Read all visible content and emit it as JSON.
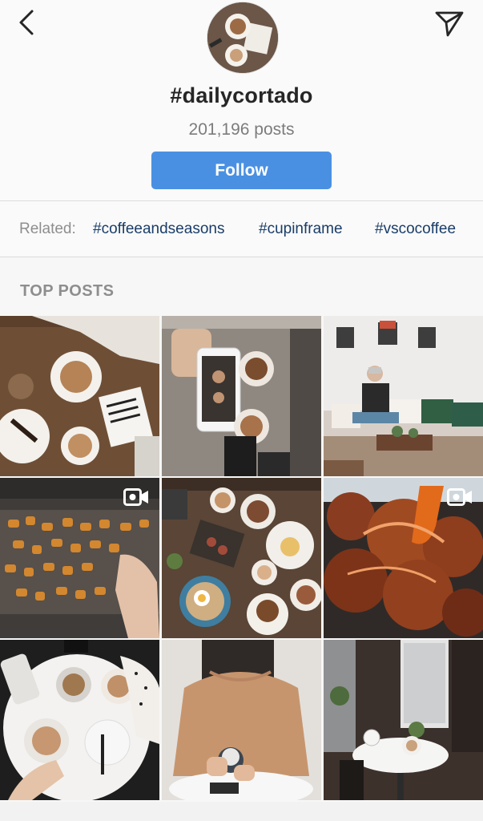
{
  "header": {
    "hashtag": "#dailycortado",
    "post_count": "201,196 posts",
    "follow_label": "Follow",
    "back_icon": "chevron-left-icon",
    "share_icon": "paper-plane-icon"
  },
  "related": {
    "label": "Related:",
    "tags": [
      "#coffeeandseasons",
      "#cupinframe",
      "#vscocoffee"
    ]
  },
  "section": {
    "title": "TOP POSTS"
  },
  "colors": {
    "follow_button": "#4a90e2",
    "related_tag": "#193d68",
    "muted_text": "#8e8e8e"
  },
  "posts": [
    {
      "subject": "latte art cups on wooden table",
      "video": false
    },
    {
      "subject": "phone photographing coffee",
      "video": false
    },
    {
      "subject": "woman in cafe corner",
      "video": false
    },
    {
      "subject": "fried snacks on cooling rack",
      "video": true
    },
    {
      "subject": "brunch table spread",
      "video": false
    },
    {
      "subject": "glazed chicken wings",
      "video": true
    },
    {
      "subject": "marble table with coffee",
      "video": false
    },
    {
      "subject": "woman holding latte",
      "video": false
    },
    {
      "subject": "cafe window table",
      "video": false
    }
  ]
}
